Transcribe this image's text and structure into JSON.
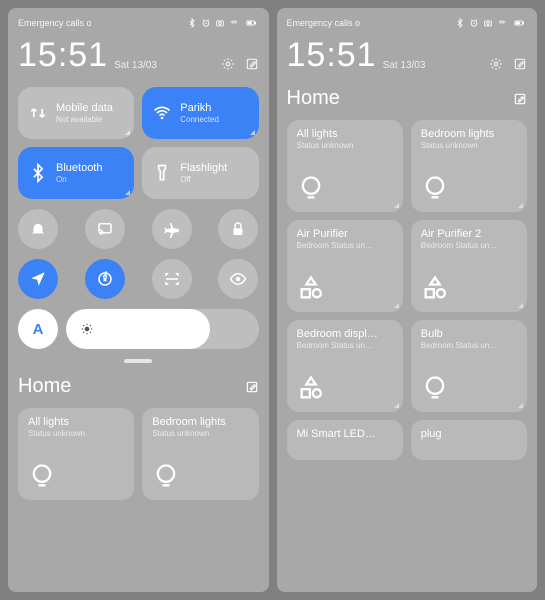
{
  "statusbar": {
    "emergency": "Emergency calls o"
  },
  "clock": {
    "time": "15:51",
    "date": "Sat 13/03"
  },
  "colors": {
    "accent": "#3B82F6"
  },
  "tiles": [
    {
      "title": "Mobile data",
      "sub": "Not available",
      "on": false,
      "icon": "data"
    },
    {
      "title": "Parikh",
      "sub": "Connected",
      "on": true,
      "icon": "wifi"
    },
    {
      "title": "Bluetooth",
      "sub": "On",
      "on": true,
      "icon": "bt"
    },
    {
      "title": "Flashlight",
      "sub": "Off",
      "on": false,
      "icon": "torch"
    }
  ],
  "icon_row1": [
    "bell",
    "cast",
    "plane",
    "lock"
  ],
  "icon_row2": [
    {
      "name": "location",
      "on": true
    },
    {
      "name": "rotate",
      "on": true
    },
    {
      "name": "scan",
      "on": false
    },
    {
      "name": "eye",
      "on": false
    }
  ],
  "auto_label": "A",
  "home": {
    "title": "Home"
  },
  "left_devices": [
    {
      "title": "All lights",
      "sub": "Status unknown",
      "icon": "bulb"
    },
    {
      "title": "Bedroom lights",
      "sub": "Status unknown",
      "icon": "bulb"
    }
  ],
  "right_devices": [
    {
      "title": "All lights",
      "sub": "Status unknown",
      "icon": "bulb"
    },
    {
      "title": "Bedroom lights",
      "sub": "Status unknown",
      "icon": "bulb"
    },
    {
      "title": "Air Purifier",
      "sub": "Bedroom Status un…",
      "icon": "shapes"
    },
    {
      "title": "Air Purifier 2",
      "sub": "Bedroom Status un…",
      "icon": "shapes"
    },
    {
      "title": "Bedroom displ…",
      "sub": "Bedroom Status un…",
      "icon": "shapes"
    },
    {
      "title": "Bulb",
      "sub": "Bedroom Status un…",
      "icon": "bulb"
    },
    {
      "title": "Mi Smart LED…",
      "sub": "",
      "icon": "shapes"
    },
    {
      "title": "plug",
      "sub": "",
      "icon": "bulb"
    }
  ]
}
